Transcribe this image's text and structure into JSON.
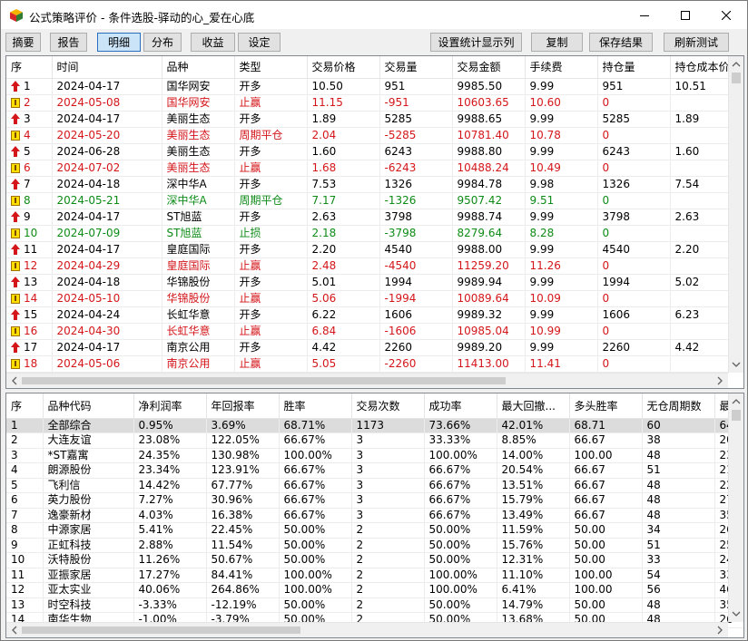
{
  "window": {
    "title": "公式策略评价 - 条件选股-驿动的心_爱在心底"
  },
  "tabs": [
    "摘要",
    "报告",
    "明细",
    "分布",
    "收益",
    "设定"
  ],
  "active_tab": "明细",
  "actions": [
    "设置统计显示列",
    "复制",
    "保存结果",
    "刷新测试"
  ],
  "colors": {
    "red": "#d4161a",
    "green": "#0e8b17",
    "selected": "#dcdcdc"
  },
  "trades": {
    "columns": [
      "序",
      "时间",
      "品种",
      "类型",
      "交易价格",
      "交易量",
      "交易金额",
      "手续费",
      "持仓量",
      "持仓成本价"
    ],
    "rows": [
      {
        "icon": "up-arrow-icon",
        "color": "black",
        "cells": [
          "1",
          "2024-04-17",
          "国华网安",
          "开多",
          "10.50",
          "951",
          "9985.50",
          "9.99",
          "951",
          "10.51"
        ]
      },
      {
        "icon": "warning-icon",
        "color": "red",
        "cells": [
          "2",
          "2024-05-08",
          "国华网安",
          "止赢",
          "11.15",
          "-951",
          "10603.65",
          "10.60",
          "0",
          ""
        ]
      },
      {
        "icon": "up-arrow-icon",
        "color": "black",
        "cells": [
          "3",
          "2024-04-17",
          "美丽生态",
          "开多",
          "1.89",
          "5285",
          "9988.65",
          "9.99",
          "5285",
          "1.89"
        ]
      },
      {
        "icon": "warning-icon",
        "color": "red",
        "cells": [
          "4",
          "2024-05-20",
          "美丽生态",
          "周期平仓",
          "2.04",
          "-5285",
          "10781.40",
          "10.78",
          "0",
          ""
        ]
      },
      {
        "icon": "up-arrow-icon",
        "color": "black",
        "cells": [
          "5",
          "2024-06-28",
          "美丽生态",
          "开多",
          "1.60",
          "6243",
          "9988.80",
          "9.99",
          "6243",
          "1.60"
        ]
      },
      {
        "icon": "warning-icon",
        "color": "red",
        "cells": [
          "6",
          "2024-07-02",
          "美丽生态",
          "止赢",
          "1.68",
          "-6243",
          "10488.24",
          "10.49",
          "0",
          ""
        ]
      },
      {
        "icon": "up-arrow-icon",
        "color": "black",
        "cells": [
          "7",
          "2024-04-18",
          "深中华A",
          "开多",
          "7.53",
          "1326",
          "9984.78",
          "9.98",
          "1326",
          "7.54"
        ]
      },
      {
        "icon": "warning-icon",
        "color": "green",
        "cells": [
          "8",
          "2024-05-21",
          "深中华A",
          "周期平仓",
          "7.17",
          "-1326",
          "9507.42",
          "9.51",
          "0",
          ""
        ]
      },
      {
        "icon": "up-arrow-icon",
        "color": "black",
        "cells": [
          "9",
          "2024-04-17",
          "ST旭蓝",
          "开多",
          "2.63",
          "3798",
          "9988.74",
          "9.99",
          "3798",
          "2.63"
        ]
      },
      {
        "icon": "warning-icon",
        "color": "green",
        "cells": [
          "10",
          "2024-07-09",
          "ST旭蓝",
          "止损",
          "2.18",
          "-3798",
          "8279.64",
          "8.28",
          "0",
          ""
        ]
      },
      {
        "icon": "up-arrow-icon",
        "color": "black",
        "cells": [
          "11",
          "2024-04-17",
          "皇庭国际",
          "开多",
          "2.20",
          "4540",
          "9988.00",
          "9.99",
          "4540",
          "2.20"
        ]
      },
      {
        "icon": "warning-icon",
        "color": "red",
        "cells": [
          "12",
          "2024-04-29",
          "皇庭国际",
          "止赢",
          "2.48",
          "-4540",
          "11259.20",
          "11.26",
          "0",
          ""
        ]
      },
      {
        "icon": "up-arrow-icon",
        "color": "black",
        "cells": [
          "13",
          "2024-04-18",
          "华锦股份",
          "开多",
          "5.01",
          "1994",
          "9989.94",
          "9.99",
          "1994",
          "5.02"
        ]
      },
      {
        "icon": "warning-icon",
        "color": "red",
        "cells": [
          "14",
          "2024-05-10",
          "华锦股份",
          "止赢",
          "5.06",
          "-1994",
          "10089.64",
          "10.09",
          "0",
          ""
        ]
      },
      {
        "icon": "up-arrow-icon",
        "color": "black",
        "cells": [
          "15",
          "2024-04-24",
          "长虹华意",
          "开多",
          "6.22",
          "1606",
          "9989.32",
          "9.99",
          "1606",
          "6.23"
        ]
      },
      {
        "icon": "warning-icon",
        "color": "red",
        "cells": [
          "16",
          "2024-04-30",
          "长虹华意",
          "止赢",
          "6.84",
          "-1606",
          "10985.04",
          "10.99",
          "0",
          ""
        ]
      },
      {
        "icon": "up-arrow-icon",
        "color": "black",
        "cells": [
          "17",
          "2024-04-17",
          "南京公用",
          "开多",
          "4.42",
          "2260",
          "9989.20",
          "9.99",
          "2260",
          "4.42"
        ]
      },
      {
        "icon": "warning-icon",
        "color": "red",
        "cells": [
          "18",
          "2024-05-06",
          "南京公用",
          "止赢",
          "5.05",
          "-2260",
          "11413.00",
          "11.41",
          "0",
          ""
        ]
      }
    ]
  },
  "stats": {
    "columns": [
      "序",
      "品种代码",
      "净利润率",
      "年回报率",
      "胜率",
      "交易次数",
      "成功率",
      "最大回撤...",
      "多头胜率",
      "无仓周期数",
      "最"
    ],
    "rows": [
      [
        "1",
        "全部综合",
        "0.95%",
        "3.69%",
        "68.71%",
        "1173",
        "73.66%",
        "42.01%",
        "68.71",
        "60",
        "64"
      ],
      [
        "2",
        "大连友谊",
        "23.08%",
        "122.05%",
        "66.67%",
        "3",
        "33.33%",
        "8.85%",
        "66.67",
        "38",
        "20"
      ],
      [
        "3",
        "*ST嘉寓",
        "24.35%",
        "130.98%",
        "100.00%",
        "3",
        "100.00%",
        "14.00%",
        "100.00",
        "48",
        "23"
      ],
      [
        "4",
        "朗源股份",
        "23.34%",
        "123.91%",
        "66.67%",
        "3",
        "66.67%",
        "20.54%",
        "66.67",
        "51",
        "21"
      ],
      [
        "5",
        "飞利信",
        "14.42%",
        "67.77%",
        "66.67%",
        "3",
        "66.67%",
        "13.51%",
        "66.67",
        "48",
        "22"
      ],
      [
        "6",
        "英力股份",
        "7.27%",
        "30.96%",
        "66.67%",
        "3",
        "66.67%",
        "15.79%",
        "66.67",
        "48",
        "27"
      ],
      [
        "7",
        "逸豪新材",
        "4.03%",
        "16.38%",
        "66.67%",
        "3",
        "66.67%",
        "13.49%",
        "66.67",
        "48",
        "35"
      ],
      [
        "8",
        "中源家居",
        "5.41%",
        "22.45%",
        "50.00%",
        "2",
        "50.00%",
        "11.59%",
        "50.00",
        "34",
        "26"
      ],
      [
        "9",
        "正虹科技",
        "2.88%",
        "11.54%",
        "50.00%",
        "2",
        "50.00%",
        "15.76%",
        "50.00",
        "51",
        "25"
      ],
      [
        "10",
        "沃特股份",
        "11.26%",
        "50.67%",
        "50.00%",
        "2",
        "50.00%",
        "12.31%",
        "50.00",
        "33",
        "24"
      ],
      [
        "11",
        "亚振家居",
        "17.27%",
        "84.41%",
        "100.00%",
        "2",
        "100.00%",
        "11.10%",
        "100.00",
        "54",
        "33"
      ],
      [
        "12",
        "亚太实业",
        "40.06%",
        "264.86%",
        "100.00%",
        "2",
        "100.00%",
        "6.41%",
        "100.00",
        "56",
        "46"
      ],
      [
        "13",
        "时空科技",
        "-3.33%",
        "-12.19%",
        "50.00%",
        "2",
        "50.00%",
        "14.79%",
        "50.00",
        "48",
        "35"
      ],
      [
        "14",
        "南华生物",
        "-1.00%",
        "-3.79%",
        "50.00%",
        "2",
        "50.00%",
        "13.68%",
        "50.00",
        "48",
        "26"
      ]
    ]
  }
}
